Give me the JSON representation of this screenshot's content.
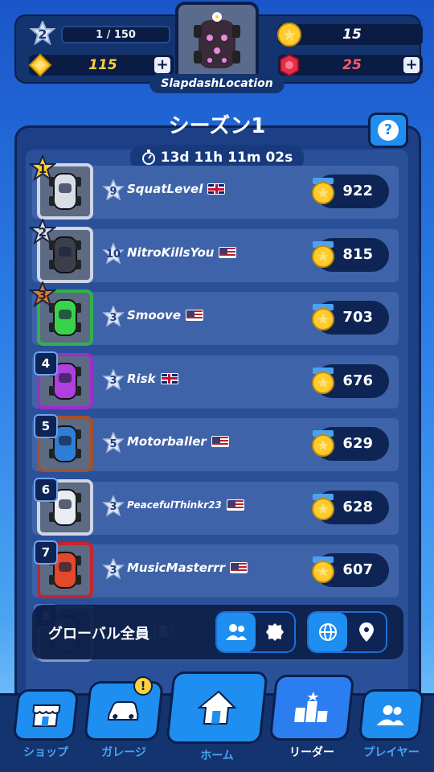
{
  "header": {
    "level": "2",
    "xp_progress": "1 / 150",
    "gems": "115",
    "coins": "15",
    "tokens": "25",
    "player_name": "SlapdashLocation"
  },
  "season": {
    "title": "シーズン1",
    "timer": "13d 11h 11m 02s"
  },
  "leaderboard": [
    {
      "rank": "1",
      "level": "9",
      "name": "SquatLevel",
      "flag": "uk",
      "score": "922",
      "tile_color": "#cfd6e4",
      "car_color": "#d9dde6"
    },
    {
      "rank": "2",
      "level": "10",
      "name": "NitroKillsYou",
      "flag": "us",
      "score": "815",
      "tile_color": "#cfd6e4",
      "car_color": "#3a3f4a"
    },
    {
      "rank": "3",
      "level": "3",
      "name": "Smoove",
      "flag": "us",
      "score": "703",
      "tile_color": "#2fb24a",
      "car_color": "#39d34a"
    },
    {
      "rank": "4",
      "level": "3",
      "name": "Risk",
      "flag": "uk",
      "score": "676",
      "tile_color": "#9b2fc9",
      "car_color": "#b13fe0"
    },
    {
      "rank": "5",
      "level": "5",
      "name": "Motorballer",
      "flag": "us",
      "score": "629",
      "tile_color": "#a0522d",
      "car_color": "#2f7fd6"
    },
    {
      "rank": "6",
      "level": "3",
      "name": "PeacefulThinkr23",
      "flag": "us",
      "score": "628",
      "tile_color": "#cfd6e4",
      "car_color": "#e9ecf2"
    },
    {
      "rank": "7",
      "level": "3",
      "name": "MusicMasterrr",
      "flag": "us",
      "score": "607",
      "tile_color": "#c8242e",
      "car_color": "#e2482a"
    },
    {
      "rank": "8",
      "level": "",
      "name": "oss",
      "flag": "ca",
      "score": "",
      "tile_color": "#cfd6e4",
      "car_color": "#777"
    }
  ],
  "filter": {
    "label": "グローバル全員"
  },
  "nav": {
    "shop": "ショップ",
    "garage": "ガレージ",
    "garage_alert": "!",
    "home": "ホーム",
    "leader": "リーダー",
    "player": "プレイヤー"
  },
  "colors": {
    "accent": "#1e8ef0",
    "panel": "#1c3f86",
    "coin": "#ffd23a",
    "token": "#e0304a"
  }
}
